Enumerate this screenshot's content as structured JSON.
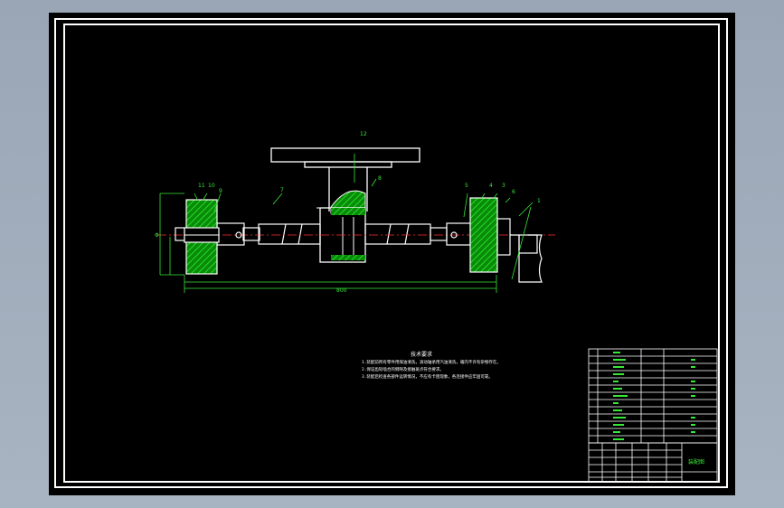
{
  "drawing": {
    "assembly_title": "装配图",
    "notes_title": "技术要求",
    "notes": [
      "1.装配前所有零件用煤油清洗，滚动轴承用汽油清洗，箱内不许有杂物存在。",
      "2.保证齿轮啮合的侧隙及接触斑点符合要求。",
      "3.装配后检查各部件运转情况，不应有卡阻现象，各连接件应牢固可靠。"
    ],
    "callouts": {
      "c1": "1",
      "c2": "3",
      "c3": "4",
      "c4": "5",
      "c5": "6",
      "c6": "7",
      "c7": "8",
      "c8": "9",
      "c9": "10",
      "c10": "11",
      "c11": "12"
    },
    "dimension_overall": "800",
    "dimension_height": "Φ"
  },
  "colors": {
    "lines": "#ffffff",
    "hatch": "#00cc00",
    "callout_text": "#38e838",
    "dim_lines": "#38e838"
  }
}
